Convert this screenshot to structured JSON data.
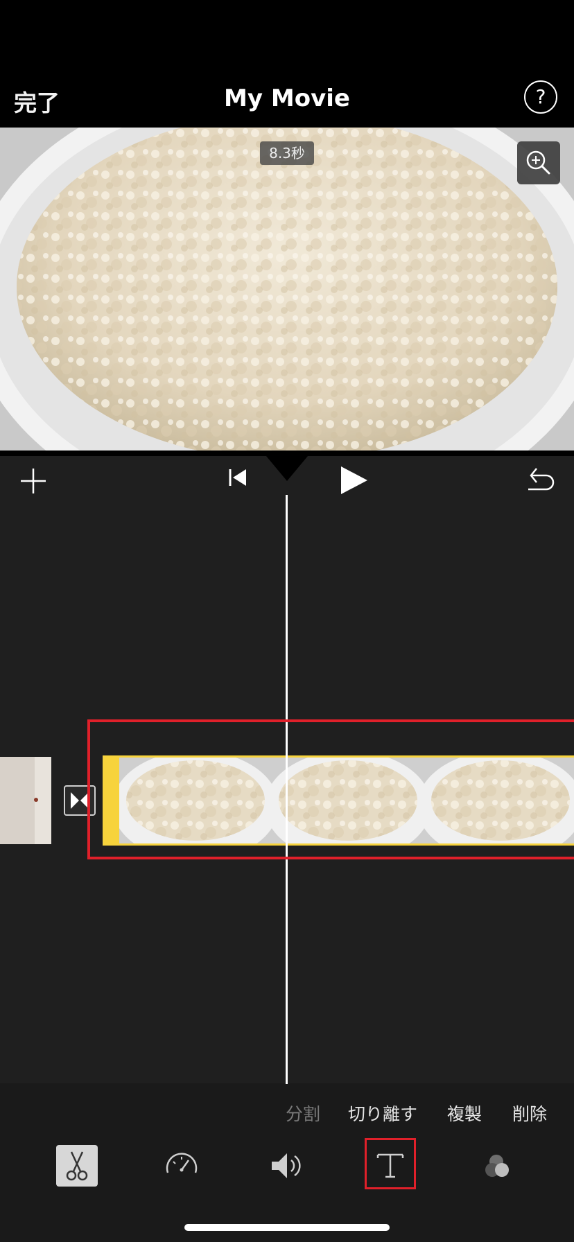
{
  "nav": {
    "done_label": "完了",
    "title": "My Movie",
    "help_label": "?"
  },
  "preview": {
    "duration_badge": "8.3秒",
    "zoom_icon": "zoom-in-icon"
  },
  "timeline_controls": {
    "add_icon": "plus-icon",
    "skip_back_icon": "skip-to-start-icon",
    "play_icon": "play-icon",
    "undo_icon": "undo-icon"
  },
  "clip_actions": [
    {
      "label": "分割",
      "enabled": false
    },
    {
      "label": "切り離す",
      "enabled": true
    },
    {
      "label": "複製",
      "enabled": true
    },
    {
      "label": "削除",
      "enabled": true
    }
  ],
  "tools": [
    {
      "icon": "scissors-icon",
      "active": true
    },
    {
      "icon": "speedometer-icon",
      "active": false
    },
    {
      "icon": "speaker-icon",
      "active": false
    },
    {
      "icon": "text-title-icon",
      "active": false
    },
    {
      "icon": "filters-icon",
      "active": false
    }
  ],
  "colors": {
    "clip_selection": "#f7d33c",
    "annotation_highlight": "#e0202a",
    "editor_background": "#1f1f1f"
  }
}
